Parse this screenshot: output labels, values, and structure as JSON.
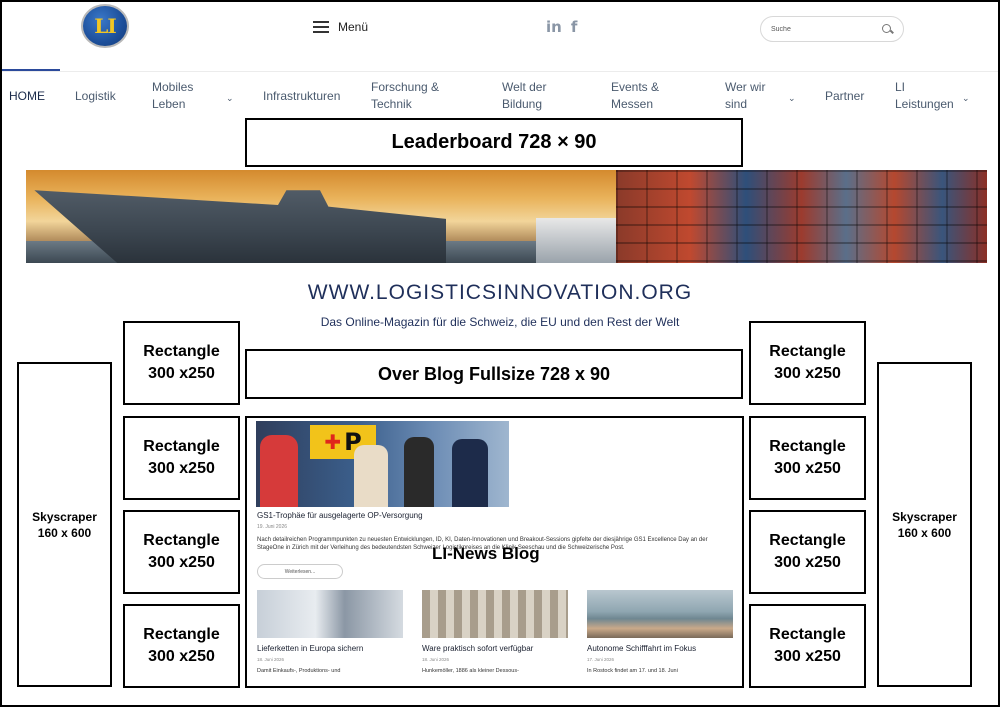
{
  "header": {
    "logo_text": "LI",
    "menu_label": "Menü",
    "social": [
      "in",
      "f"
    ],
    "search_placeholder": "Suche"
  },
  "nav": {
    "items": [
      {
        "label": "HOME",
        "active": true
      },
      {
        "label": "Logistik"
      },
      {
        "label": "Mobiles Leben",
        "dropdown": true
      },
      {
        "label": "Infrastrukturen"
      },
      {
        "label": "Forschung & Technik"
      },
      {
        "label": "Welt der Bildung"
      },
      {
        "label": "Events & Messen"
      },
      {
        "label": "Wer wir sind",
        "dropdown": true
      },
      {
        "label": "Partner"
      },
      {
        "label": "LI Leistungen",
        "dropdown": true
      }
    ]
  },
  "ads": {
    "leaderboard": "Leaderboard 728 × 90",
    "over_blog": "Over Blog Fullsize 728 x 90",
    "rectangle_line1": "Rectangle",
    "rectangle_line2": "300 x250",
    "skyscraper_line1": "Skyscraper",
    "skyscraper_line2": "160 x 600"
  },
  "site": {
    "url": "WWW.LOGISTICSINNOVATION.ORG",
    "tagline": "Das Online-Magazin für die Schweiz, die EU und den Rest der Welt"
  },
  "blog": {
    "title": "LI-News Blog",
    "featured": {
      "sign_text": "P",
      "title": "GS1-Trophäe für ausgelagerte OP-Versorgung",
      "date": "19. Juni 2026",
      "excerpt": "Nach detailreichen Programmpunkten zu neuesten Entwicklungen, ID, KI, Daten-Innovationen und Breakout-Sessions gipfelte der diesjährige GS1 Excellence Day an der StageOne in Zürich mit der Verleihung des bedeutendsten Schweizer Logistikpreises an die Klinik Seeschau und die Schweizerische Post.",
      "read_more": "Weiterlesen..."
    },
    "cards": [
      {
        "title": "Lieferketten in Europa sichern",
        "date": "18. Juni 2026",
        "excerpt": "Damit Einkaufs-, Produktions- und"
      },
      {
        "title": "Ware praktisch sofort verfügbar",
        "date": "18. Juni 2026",
        "excerpt": "Hunkemöller, 1886 als kleiner Dessous-"
      },
      {
        "title": "Autonome Schifffahrt im Fokus",
        "date": "17. Juni 2026",
        "excerpt": "In Rostock findet am 17. und 18. Juni"
      }
    ]
  }
}
